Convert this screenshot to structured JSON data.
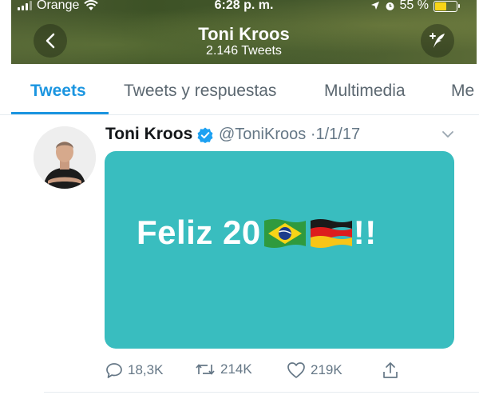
{
  "status_bar": {
    "carrier": "Orange",
    "time": "6:28 p. m.",
    "battery": "55 %"
  },
  "header": {
    "title": "Toni Kroos",
    "subtitle": "2.146 Tweets"
  },
  "tabs": [
    {
      "label": "Tweets",
      "active": true
    },
    {
      "label": "Tweets y respuestas",
      "active": false
    },
    {
      "label": "Multimedia",
      "active": false
    },
    {
      "label": "Me",
      "active": false
    }
  ],
  "tweet": {
    "author_name": "Toni Kroos",
    "handle": "@ToniKroos",
    "separator": "·",
    "date": "1/1/17",
    "media_text_prefix": "Feliz 20",
    "media_text_suffix": "!!",
    "media_flags": [
      "brazil-flag",
      "germany-flag"
    ],
    "actions": {
      "replies": "18,3K",
      "retweets": "214K",
      "likes": "219K"
    }
  },
  "colors": {
    "accent": "#1b95e0",
    "media_bg": "#39bdbf",
    "verified": "#1da1f2"
  }
}
